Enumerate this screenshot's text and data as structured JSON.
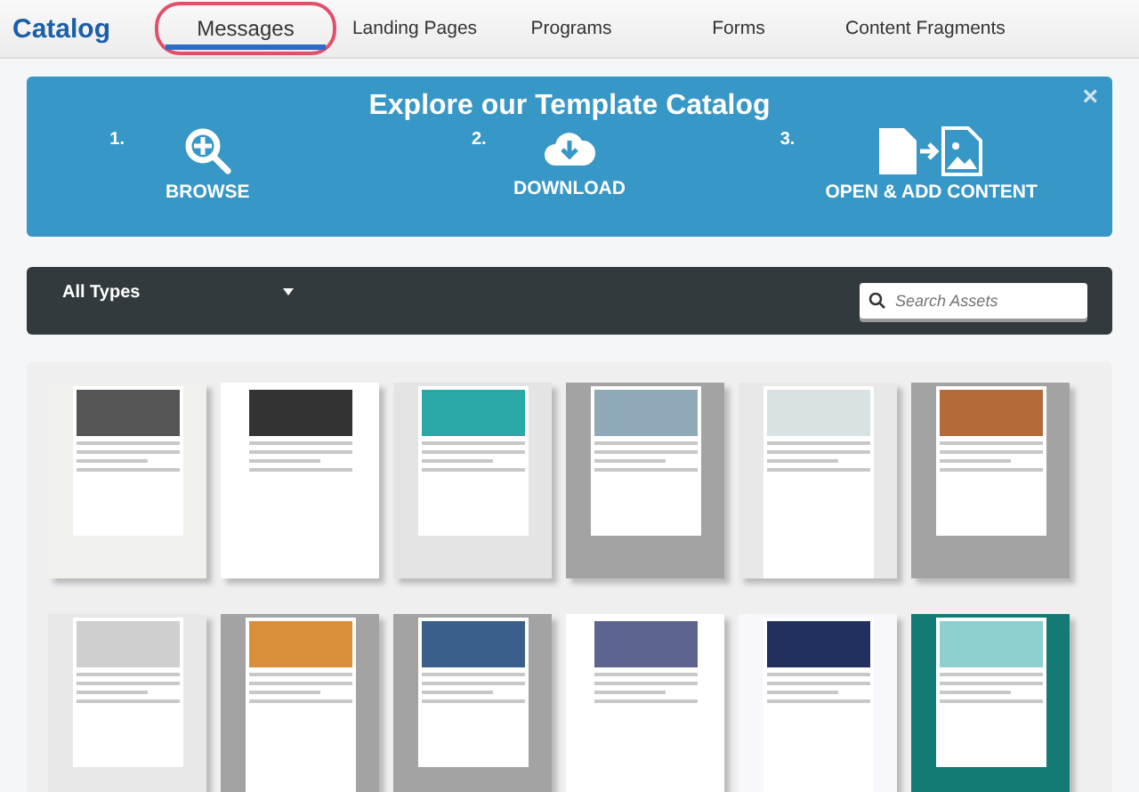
{
  "header": {
    "title": "Catalog",
    "tabs": [
      {
        "label": "Messages",
        "selected": true,
        "highlighted": true
      },
      {
        "label": "Landing Pages",
        "selected": false,
        "highlighted": false
      },
      {
        "label": "Programs",
        "selected": false,
        "highlighted": false
      },
      {
        "label": "Forms",
        "selected": false,
        "highlighted": false
      },
      {
        "label": "Content Fragments",
        "selected": false,
        "highlighted": false
      }
    ]
  },
  "banner": {
    "title": "Explore our Template Catalog",
    "close": "×",
    "steps": [
      {
        "number": "1.",
        "label": "BROWSE",
        "kind": "browse"
      },
      {
        "number": "2.",
        "label": "DOWNLOAD",
        "kind": "download"
      },
      {
        "number": "3.",
        "label": "OPEN & ADD CONTENT",
        "kind": "open"
      }
    ]
  },
  "toolbar": {
    "type_filter": "All Types",
    "search": {
      "placeholder": "Search Assets"
    }
  }
}
